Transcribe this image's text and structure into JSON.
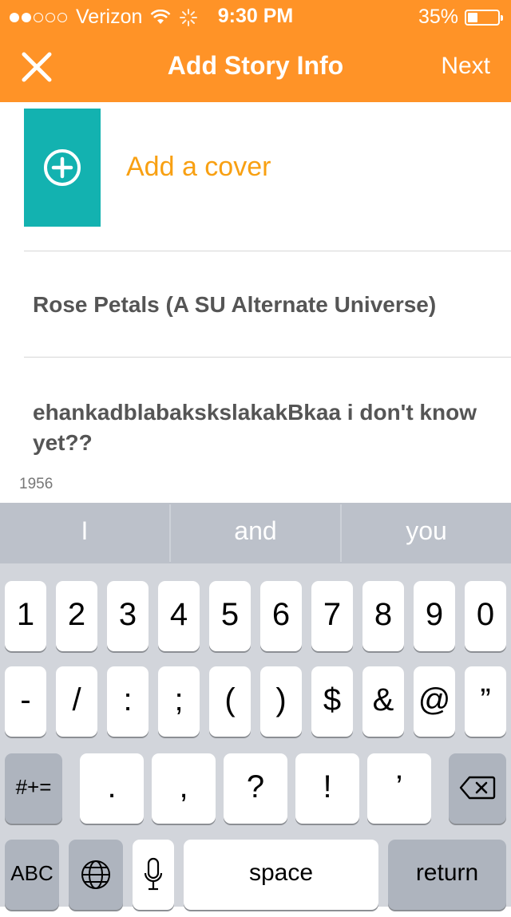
{
  "status_bar": {
    "carrier": "Verizon",
    "time": "9:30 PM",
    "battery": "35%",
    "icons": [
      "signal-dots",
      "wifi-icon",
      "activity-spinner-icon",
      "battery-icon"
    ]
  },
  "nav": {
    "close_icon": "close-icon",
    "title": "Add Story Info",
    "next_label": "Next"
  },
  "cover": {
    "icon": "add-circle-icon",
    "label": "Add a cover"
  },
  "story": {
    "title_value": "Rose Petals (A SU Alternate Universe)",
    "description_value": "ehankadblabakskslakakBkaa i don't know yet??",
    "remaining_count": "1956"
  },
  "keyboard": {
    "predictions": [
      "I",
      "and",
      "you"
    ],
    "row1": [
      "1",
      "2",
      "3",
      "4",
      "5",
      "6",
      "7",
      "8",
      "9",
      "0"
    ],
    "row2": [
      "-",
      "/",
      ":",
      ";",
      "(",
      ")",
      "$",
      "&",
      "@",
      "”"
    ],
    "row3_mode": "#+=",
    "row3": [
      ".",
      ",",
      "?",
      "!",
      "’"
    ],
    "row3_delete": "delete-icon",
    "row4": {
      "abc": "ABC",
      "globe": "globe-icon",
      "mic": "microphone-icon",
      "space": "space",
      "return": "return"
    }
  },
  "colors": {
    "header": "#FF9327",
    "cover_box": "#13B2B0",
    "cover_text": "#F8A012"
  }
}
